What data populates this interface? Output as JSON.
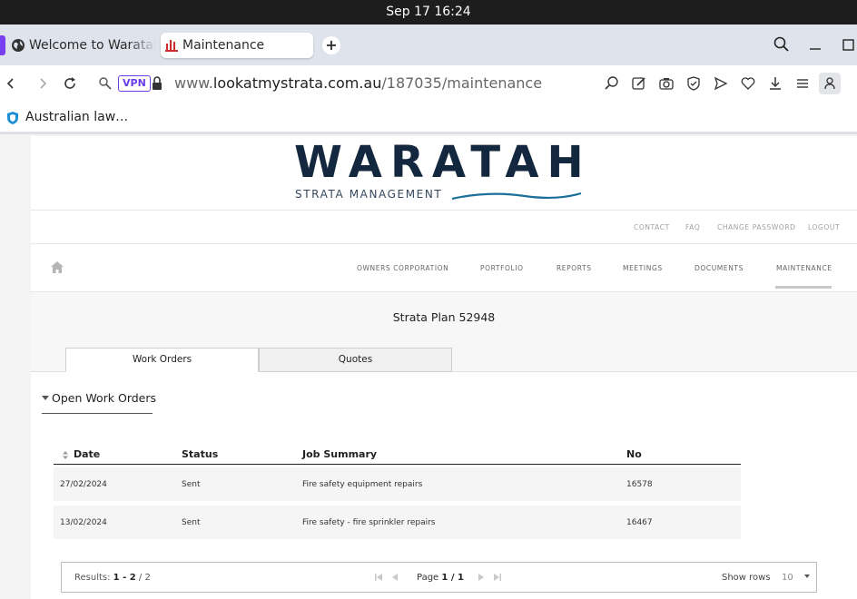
{
  "os": {
    "datetime": "Sep 17  16:24"
  },
  "browser": {
    "tabs": [
      {
        "title": "Welcome to Waratah"
      },
      {
        "title": "Maintenance"
      }
    ],
    "vpn_label": "VPN",
    "url": {
      "prefix": "www.",
      "host": "lookatmystrata.com.au",
      "path": "/187035/maintenance"
    },
    "bookmark": {
      "label": "Australian law…"
    }
  },
  "site": {
    "logo": {
      "word": "WARATAH",
      "sub": "STRATA MANAGEMENT"
    },
    "util_links": [
      "CONTACT",
      "FAQ",
      "CHANGE PASSWORD",
      "LOGOUT"
    ],
    "nav_links": [
      "OWNERS CORPORATION",
      "PORTFOLIO",
      "REPORTS",
      "MEETINGS",
      "DOCUMENTS",
      "MAINTENANCE"
    ],
    "active_nav": "MAINTENANCE"
  },
  "page": {
    "strata_title": "Strata Plan 52948",
    "tabs": [
      {
        "label": "Work Orders",
        "active": true
      },
      {
        "label": "Quotes",
        "active": false
      }
    ],
    "section_title": "Open Work Orders",
    "table": {
      "headers": [
        "Date",
        "Status",
        "Job Summary",
        "No"
      ],
      "rows": [
        {
          "date": "27/02/2024",
          "status": "Sent",
          "summary": "Fire safety equipment repairs",
          "no": "16578"
        },
        {
          "date": "13/02/2024",
          "status": "Sent",
          "summary": "Fire safety - fire sprinkler repairs",
          "no": "16467"
        }
      ]
    },
    "pager": {
      "results_label": "Results:",
      "results_range": "1 - 2",
      "results_total": "/ 2",
      "page_label": "Page",
      "page_value": "1 / 1",
      "show_rows_label": "Show rows",
      "rows_value": "10"
    }
  },
  "colors": {
    "brand_navy": "#13273f",
    "vpn_purple": "#6a3de8",
    "tab_accent": "#7b3ff2"
  }
}
